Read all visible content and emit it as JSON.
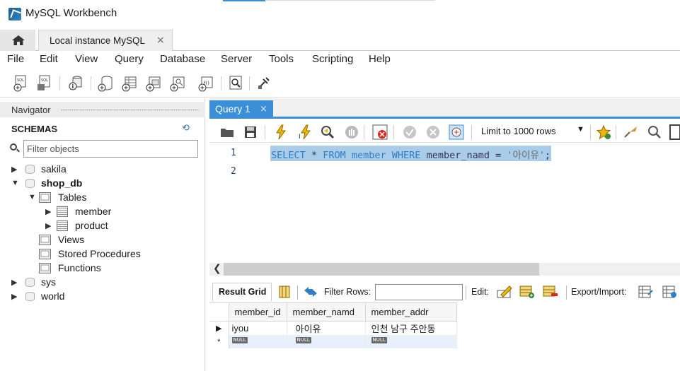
{
  "window": {
    "title": "MySQL Workbench"
  },
  "tabs": {
    "connection_label": "Local instance MySQL",
    "close_glyph": "×"
  },
  "menu": [
    "File",
    "Edit",
    "View",
    "Query",
    "Database",
    "Server",
    "Tools",
    "Scripting",
    "Help"
  ],
  "navigator": {
    "header": "Navigator",
    "schemas_title": "SCHEMAS",
    "filter_placeholder": "Filter objects",
    "tree": {
      "sakila": "sakila",
      "shop_db": "shop_db",
      "tables": "Tables",
      "member": "member",
      "product": "product",
      "views": "Views",
      "stored_procedures": "Stored Procedures",
      "functions": "Functions",
      "sys": "sys",
      "world": "world"
    }
  },
  "editor": {
    "tab_label": "Query 1",
    "limit_select": "Limit to 1000 rows",
    "line_numbers": [
      "1",
      "2"
    ],
    "sql": {
      "kw1": "SELECT",
      "star": "*",
      "kw2": "FROM",
      "table": "member",
      "kw3": "WHERE",
      "column": "member_namd",
      "op": "=",
      "value": "'아이유'",
      "end": ";"
    }
  },
  "results": {
    "result_grid_label": "Result Grid",
    "filter_rows_label": "Filter Rows:",
    "edit_label": "Edit:",
    "export_label": "Export/Import:",
    "columns": [
      "member_id",
      "member_namd",
      "member_addr"
    ],
    "rows": [
      [
        "iyou",
        "아이유",
        "인천 남구 주안동"
      ]
    ],
    "null_badge": "NULL",
    "current_row_marker": "▶",
    "new_row_marker": "*"
  },
  "colors": {
    "accent": "#3b8fd9",
    "selection": "#a9cde9",
    "keyword": "#2b7cc6"
  },
  "icons": [
    "home-icon",
    "new-sql-tab-icon",
    "open-sql-script-icon",
    "inspector-icon",
    "create-schema-icon",
    "create-table-icon",
    "create-view-icon",
    "create-procedure-icon",
    "create-function-icon",
    "search-table-data-icon",
    "reconnect-icon",
    "open-file-icon",
    "save-icon",
    "execute-icon",
    "execute-current-icon",
    "explain-icon",
    "stop-icon",
    "toggle-error-icon",
    "commit-icon",
    "rollback-icon",
    "autocommit-icon",
    "beautify-icon",
    "find-icon",
    "wrap-icon",
    "refresh-icon"
  ]
}
